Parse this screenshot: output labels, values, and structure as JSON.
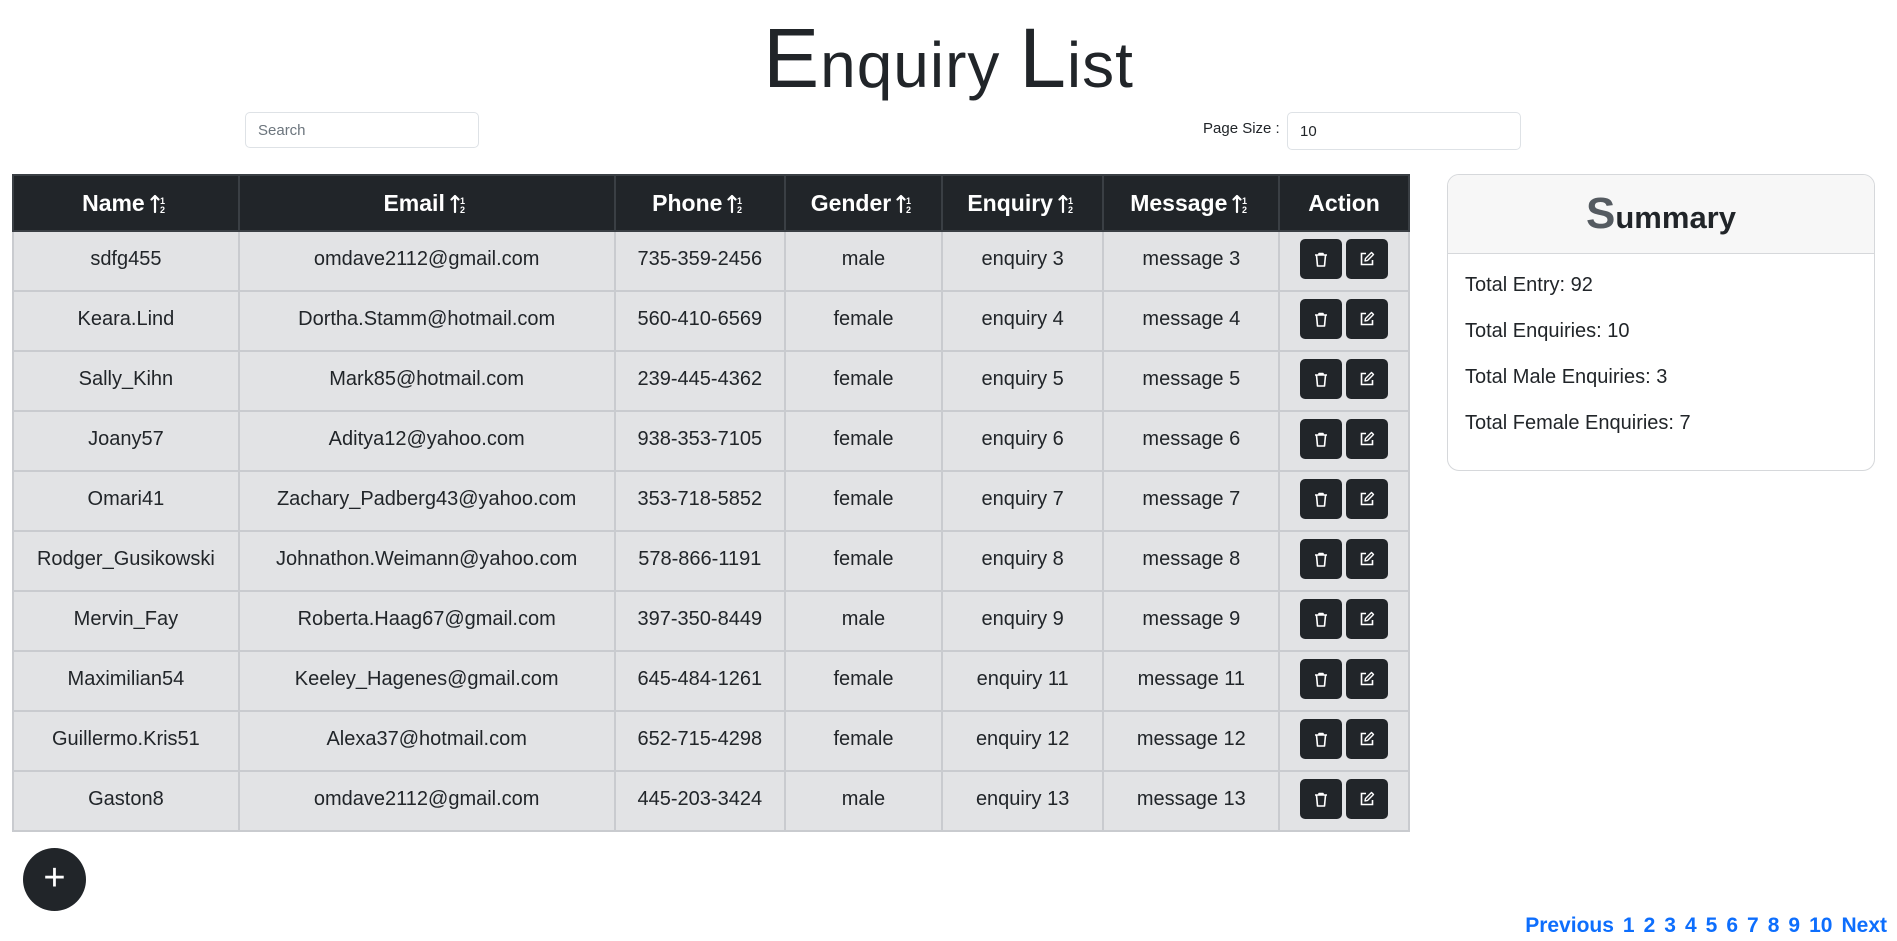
{
  "page": {
    "title_first_cap": "E",
    "title_first_rest": "nquiry ",
    "title_second_cap": "L",
    "title_second_rest": "ist"
  },
  "search": {
    "placeholder": "Search",
    "value": ""
  },
  "page_size": {
    "label": "Page Size :",
    "value": "10"
  },
  "table": {
    "columns": [
      "Name",
      "Email",
      "Phone",
      "Gender",
      "Enquiry",
      "Message",
      "Action"
    ],
    "rows": [
      {
        "name": "sdfg455",
        "email": "omdave2112@gmail.com",
        "phone": "735-359-2456",
        "gender": "male",
        "enquiry": "enquiry 3",
        "message": "message 3"
      },
      {
        "name": "Keara.Lind",
        "email": "Dortha.Stamm@hotmail.com",
        "phone": "560-410-6569",
        "gender": "female",
        "enquiry": "enquiry 4",
        "message": "message 4"
      },
      {
        "name": "Sally_Kihn",
        "email": "Mark85@hotmail.com",
        "phone": "239-445-4362",
        "gender": "female",
        "enquiry": "enquiry 5",
        "message": "message 5"
      },
      {
        "name": "Joany57",
        "email": "Aditya12@yahoo.com",
        "phone": "938-353-7105",
        "gender": "female",
        "enquiry": "enquiry 6",
        "message": "message 6"
      },
      {
        "name": "Omari41",
        "email": "Zachary_Padberg43@yahoo.com",
        "phone": "353-718-5852",
        "gender": "female",
        "enquiry": "enquiry 7",
        "message": "message 7"
      },
      {
        "name": "Rodger_Gusikowski",
        "email": "Johnathon.Weimann@yahoo.com",
        "phone": "578-866-1191",
        "gender": "female",
        "enquiry": "enquiry 8",
        "message": "message 8"
      },
      {
        "name": "Mervin_Fay",
        "email": "Roberta.Haag67@gmail.com",
        "phone": "397-350-8449",
        "gender": "male",
        "enquiry": "enquiry 9",
        "message": "message 9"
      },
      {
        "name": "Maximilian54",
        "email": "Keeley_Hagenes@gmail.com",
        "phone": "645-484-1261",
        "gender": "female",
        "enquiry": "enquiry 11",
        "message": "message 11"
      },
      {
        "name": "Guillermo.Kris51",
        "email": "Alexa37@hotmail.com",
        "phone": "652-715-4298",
        "gender": "female",
        "enquiry": "enquiry 12",
        "message": "message 12"
      },
      {
        "name": "Gaston8",
        "email": "omdave2112@gmail.com",
        "phone": "445-203-3424",
        "gender": "male",
        "enquiry": "enquiry 13",
        "message": "message 13"
      }
    ]
  },
  "summary": {
    "title_cap": "S",
    "title_rest": "ummary",
    "items": [
      "Total Entry: 92",
      "Total Enquiries: 10",
      "Total Male Enquiries: 3",
      "Total Female Enquiries: 7"
    ]
  },
  "add_button": {
    "label": "+"
  },
  "pagination": {
    "previous": "Previous",
    "pages": [
      "1",
      "2",
      "3",
      "4",
      "5",
      "6",
      "7",
      "8",
      "9",
      "10"
    ],
    "next": "Next"
  },
  "icons": {
    "sort": "sort-alpha-icon",
    "delete": "trash-icon",
    "edit": "edit-icon",
    "add": "plus-icon"
  },
  "colors": {
    "dark": "#212529",
    "row_bg": "#e2e3e5",
    "link": "#0d6efd"
  }
}
